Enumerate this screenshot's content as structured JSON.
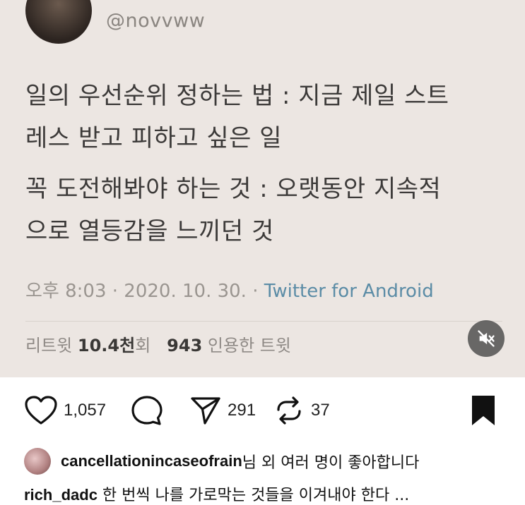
{
  "tweet": {
    "handle": "@novvww",
    "lines": [
      "일의 우선순위 정하는 법 : 지금 제일 스트",
      "레스 받고 피하고 싶은 일",
      "꼭 도전해봐야 하는 것 : 오랫동안 지속적",
      "으로 열등감을 느끼던 것"
    ],
    "time": "오후 8:03 · 2020. 10. 30. · ",
    "source": "Twitter for Android",
    "retweet_label": "리트윗",
    "retweet_count": "10.4천",
    "retweet_unit": "회",
    "quote_count": "943",
    "quote_label": "인용한 트윗"
  },
  "actions": {
    "likes": "1,057",
    "shares": "291",
    "reposts": "37"
  },
  "liked_by": {
    "user": "cancellationincaseofrain",
    "text": "님 외 여러 명이 좋아합니다"
  },
  "caption": {
    "user": "rich_dadc",
    "text": " 한 번씩 나를 가로막는 것들을 이겨내야 한다 ..."
  },
  "icons": {
    "mute": "speaker-muted-icon",
    "like": "heart-icon",
    "comment": "comment-bubble-icon",
    "share": "paper-plane-icon",
    "repost": "repost-icon",
    "save": "bookmark-icon"
  }
}
